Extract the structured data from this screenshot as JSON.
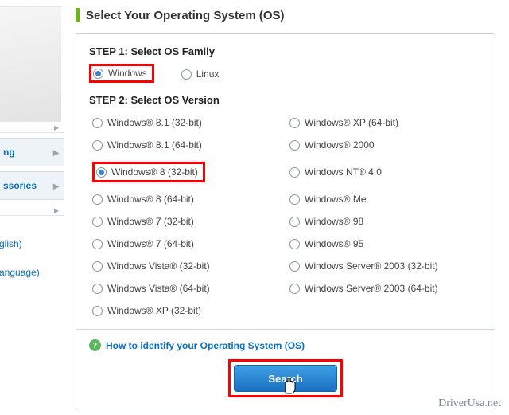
{
  "sidebar": {
    "tabs": [
      "ng",
      "ssories"
    ],
    "links": [
      "glish)",
      "anguage)"
    ]
  },
  "header": {
    "title": "Select Your Operating System (OS)"
  },
  "step1": {
    "label": "STEP 1: Select OS Family",
    "options": [
      {
        "label": "Windows",
        "selected": true
      },
      {
        "label": "Linux",
        "selected": false
      }
    ]
  },
  "step2": {
    "label": "STEP 2: Select OS Version",
    "left": [
      {
        "label": "Windows® 8.1 (32-bit)",
        "selected": false
      },
      {
        "label": "Windows® 8.1 (64-bit)",
        "selected": false
      },
      {
        "label": "Windows® 8 (32-bit)",
        "selected": true
      },
      {
        "label": "Windows® 8 (64-bit)",
        "selected": false
      },
      {
        "label": "Windows® 7 (32-bit)",
        "selected": false
      },
      {
        "label": "Windows® 7 (64-bit)",
        "selected": false
      },
      {
        "label": "Windows Vista® (32-bit)",
        "selected": false
      },
      {
        "label": "Windows Vista® (64-bit)",
        "selected": false
      },
      {
        "label": "Windows® XP (32-bit)",
        "selected": false
      }
    ],
    "right": [
      {
        "label": "Windows® XP (64-bit)",
        "selected": false
      },
      {
        "label": "Windows® 2000",
        "selected": false
      },
      {
        "label": "Windows NT® 4.0",
        "selected": false
      },
      {
        "label": "Windows® Me",
        "selected": false
      },
      {
        "label": "Windows® 98",
        "selected": false
      },
      {
        "label": "Windows® 95",
        "selected": false
      },
      {
        "label": "Windows Server® 2003 (32-bit)",
        "selected": false
      },
      {
        "label": "Windows Server® 2003 (64-bit)",
        "selected": false
      }
    ]
  },
  "help": {
    "text": "How to identify your Operating System (OS)"
  },
  "actions": {
    "search": "Search"
  },
  "watermark": "DriverUsa.net"
}
